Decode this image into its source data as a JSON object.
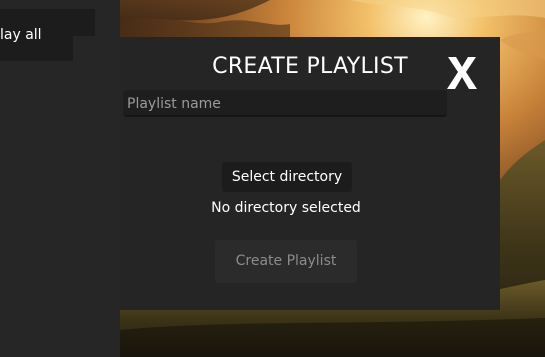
{
  "sidebar": {
    "play_all_label": "lay all"
  },
  "dialog": {
    "title": "CREATE PLAYLIST",
    "close_label": "X",
    "name_placeholder": "Playlist name",
    "name_value": "",
    "select_directory_label": "Select directory",
    "directory_status": "No directory selected",
    "create_label": "Create Playlist",
    "create_enabled": false
  },
  "colors": {
    "dialog_bg": "#252525",
    "panel_bg": "#262626",
    "button_bg": "#1c1c1c",
    "disabled_text": "#8c8c8c",
    "text": "#ffffff"
  }
}
